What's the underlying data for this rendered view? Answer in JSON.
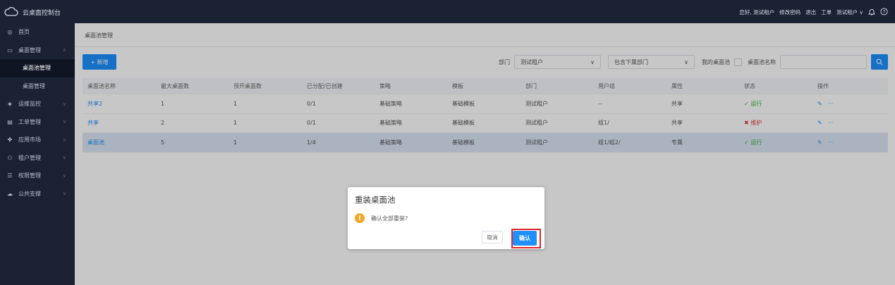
{
  "app": {
    "title": "云桌面控制台"
  },
  "topbar": {
    "greeting": "您好, 测试租户",
    "change_password": "修改密码",
    "logout": "退出",
    "ticket": "工单",
    "tenant": "测试租户 ∨",
    "bell_icon": "bell-icon",
    "help_icon": "help-icon"
  },
  "sidebar": {
    "items": [
      {
        "icon": "◎",
        "label": "首页"
      },
      {
        "icon": "▭",
        "label": "桌面管理",
        "chev": "∧"
      },
      {
        "icon": "◈",
        "label": "运维监控",
        "chev": "∨"
      },
      {
        "icon": "▤",
        "label": "工单管理",
        "chev": "∨"
      },
      {
        "icon": "✤",
        "label": "应用市场",
        "chev": "∨"
      },
      {
        "icon": "⚇",
        "label": "租户管理",
        "chev": "∨"
      },
      {
        "icon": "☰",
        "label": "权限管理",
        "chev": "∨"
      },
      {
        "icon": "☁",
        "label": "公共支撑",
        "chev": "∨"
      }
    ],
    "sub_items": [
      "桌面池管理",
      "桌面管理"
    ]
  },
  "main": {
    "breadcrumb": "桌面池管理",
    "add_button": "+ 新增",
    "filters": {
      "dept_label": "部门",
      "dept_value": "测试租户",
      "include_sub": "包含下属部门",
      "my_pool": "我的桌面池",
      "pool_name_label": "桌面池名称",
      "pool_name_value": ""
    },
    "table": {
      "headers": [
        "桌面池名称",
        "最大桌面数",
        "预开桌面数",
        "已分配/已创建",
        "策略",
        "模板",
        "部门",
        "用户组",
        "属性",
        "状态",
        "操作"
      ],
      "rows": [
        {
          "name": "共享2",
          "max": "1",
          "pre": "1",
          "alloc": "0/1",
          "policy": "基础策略",
          "template": "基础模板",
          "dept": "测试租户",
          "group": "--",
          "attr": "共享",
          "status": "✓ 运行",
          "status_color": "#2db52d"
        },
        {
          "name": "共享",
          "max": "2",
          "pre": "1",
          "alloc": "0/1",
          "policy": "基础策略",
          "template": "基础模板",
          "dept": "测试租户",
          "group": "组1/",
          "attr": "共享",
          "status": "✖ 维护",
          "status_color": "#e03a3a"
        },
        {
          "name": "桌面池",
          "max": "5",
          "pre": "1",
          "alloc": "1/4",
          "policy": "基础策略",
          "template": "基础模板",
          "dept": "测试租户",
          "group": "组1/组2/",
          "attr": "专属",
          "status": "✓ 运行",
          "status_color": "#2db52d"
        }
      ]
    }
  },
  "dialog": {
    "title": "重装桌面池",
    "message": "确认全部重装?",
    "cancel": "取消",
    "confirm": "确认"
  }
}
